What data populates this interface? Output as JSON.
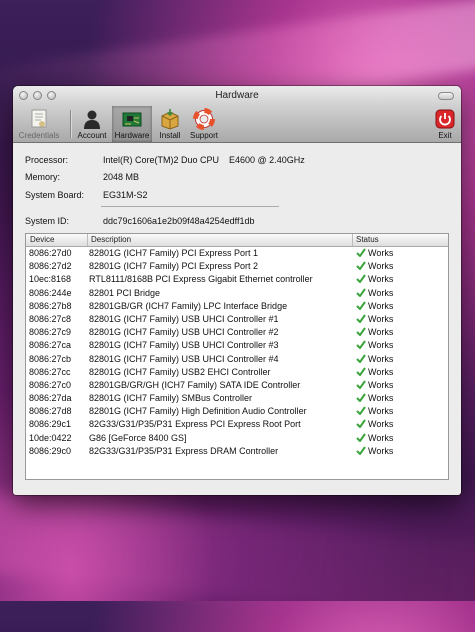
{
  "window": {
    "title": "Hardware"
  },
  "toolbar": {
    "credentials": "Credentials",
    "account": "Account",
    "hardware": "Hardware",
    "install": "Install",
    "support": "Support",
    "exit": "Exit"
  },
  "info": {
    "processor_label": "Processor:",
    "processor_value": "Intel(R) Core(TM)2 Duo CPU    E4600 @ 2.40GHz",
    "memory_label": "Memory:",
    "memory_value": "2048 MB",
    "board_label": "System Board:",
    "board_value": "EG31M-S2",
    "sysid_label": "System ID:",
    "sysid_value": "ddc79c1606a1e2b09f48a4254edff1db"
  },
  "table": {
    "headers": {
      "device": "Device",
      "description": "Description",
      "status": "Status"
    },
    "rows": [
      {
        "device": "8086:27d0",
        "description": "82801G (ICH7 Family) PCI Express Port 1",
        "status": "Works"
      },
      {
        "device": "8086:27d2",
        "description": "82801G (ICH7 Family) PCI Express Port 2",
        "status": "Works"
      },
      {
        "device": "10ec:8168",
        "description": "RTL8111/8168B PCI Express Gigabit Ethernet controller",
        "status": "Works"
      },
      {
        "device": "8086:244e",
        "description": "82801 PCI Bridge",
        "status": "Works"
      },
      {
        "device": "8086:27b8",
        "description": "82801GB/GR (ICH7 Family) LPC Interface Bridge",
        "status": "Works"
      },
      {
        "device": "8086:27c8",
        "description": "82801G (ICH7 Family) USB UHCI Controller #1",
        "status": "Works"
      },
      {
        "device": "8086:27c9",
        "description": "82801G (ICH7 Family) USB UHCI Controller #2",
        "status": "Works"
      },
      {
        "device": "8086:27ca",
        "description": "82801G (ICH7 Family) USB UHCI Controller #3",
        "status": "Works"
      },
      {
        "device": "8086:27cb",
        "description": "82801G (ICH7 Family) USB UHCI Controller #4",
        "status": "Works"
      },
      {
        "device": "8086:27cc",
        "description": "82801G (ICH7 Family) USB2 EHCI Controller",
        "status": "Works"
      },
      {
        "device": "8086:27c0",
        "description": "82801GB/GR/GH (ICH7 Family) SATA IDE Controller",
        "status": "Works"
      },
      {
        "device": "8086:27da",
        "description": "82801G (ICH7 Family) SMBus Controller",
        "status": "Works"
      },
      {
        "device": "8086:27d8",
        "description": "82801G (ICH7 Family) High Definition Audio Controller",
        "status": "Works"
      },
      {
        "device": "8086:29c1",
        "description": "82G33/G31/P35/P31 Express PCI Express Root Port",
        "status": "Works"
      },
      {
        "device": "10de:0422",
        "description": "G86 [GeForce 8400 GS]",
        "status": "Works"
      },
      {
        "device": "8086:29c0",
        "description": "82G33/G31/P35/P31 Express DRAM Controller",
        "status": "Works"
      }
    ]
  },
  "colors": {
    "check": "#3aa43a",
    "exit": "#d8262a",
    "support_ring": "#e8512c"
  },
  "icons": {
    "credentials": "certificate-icon",
    "account": "person-icon",
    "hardware": "circuit-board-icon",
    "install": "package-icon",
    "support": "lifebuoy-icon",
    "exit": "power-icon",
    "status": "checkmark-icon"
  }
}
